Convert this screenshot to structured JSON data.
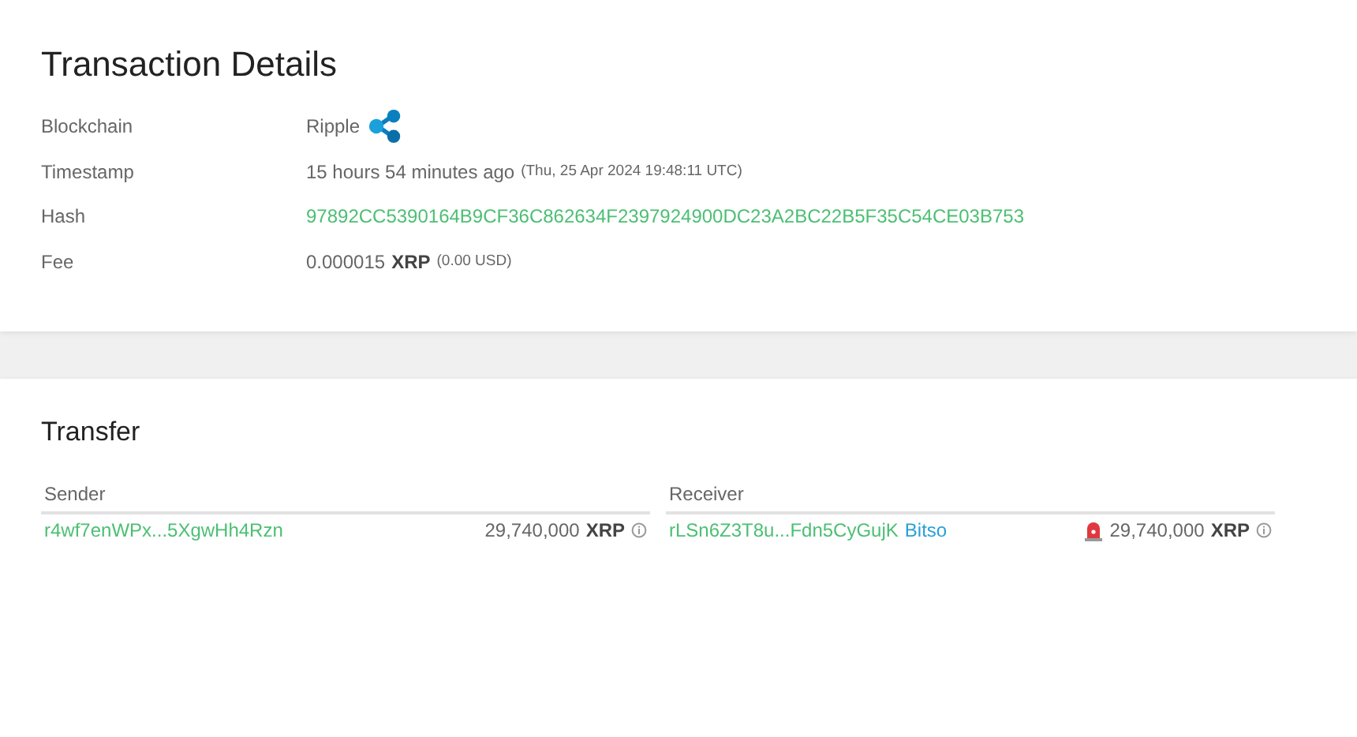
{
  "details": {
    "title": "Transaction Details",
    "rows": [
      {
        "kind": "chain",
        "label": "Blockchain",
        "value": "Ripple"
      },
      {
        "kind": "time",
        "label": "Timestamp",
        "value": "15 hours 54 minutes ago",
        "note": "(Thu, 25 Apr 2024 19:48:11 UTC)"
      },
      {
        "kind": "hash",
        "label": "Hash",
        "value": "97892CC5390164B9CF36C862634F2397924900DC23A2BC22B5F35C54CE03B753"
      },
      {
        "kind": "fee",
        "label": "Fee",
        "value": "0.000015",
        "unit": "XRP",
        "note": "(0.00 USD)"
      }
    ]
  },
  "transfer": {
    "title": "Transfer",
    "parties": [
      {
        "heading": "Sender",
        "address": "r4wf7enWPx...5XgwHh4Rzn",
        "amount": "29,740,000",
        "unit": "XRP",
        "alert": false
      },
      {
        "heading": "Receiver",
        "address": "rLSn6Z3T8u...Fdn5CyGujK",
        "tag": "Bitso",
        "amount": "29,740,000",
        "unit": "XRP",
        "alert": true
      }
    ]
  }
}
